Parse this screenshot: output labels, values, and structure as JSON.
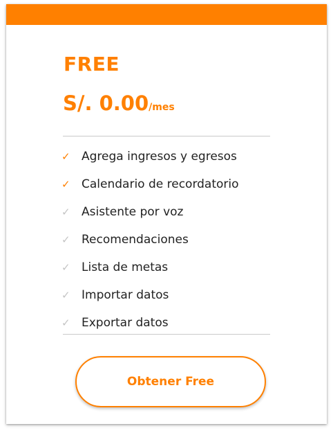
{
  "plan": {
    "name": "FREE",
    "price": "S/. 0.00",
    "period": "/mes"
  },
  "features": [
    {
      "label": "Agrega ingresos y egresos",
      "included": true
    },
    {
      "label": "Calendario de recordatorio",
      "included": true
    },
    {
      "label": "Asistente por voz",
      "included": false
    },
    {
      "label": "Recomendaciones",
      "included": false
    },
    {
      "label": "Lista de metas",
      "included": false
    },
    {
      "label": "Importar datos",
      "included": false
    },
    {
      "label": "Exportar datos",
      "included": false
    }
  ],
  "check_glyph": "✓",
  "cta": {
    "label": "Obtener Free"
  },
  "colors": {
    "accent": "#FF8000",
    "check_inactive": "#c4c4c4",
    "text": "#222222"
  }
}
